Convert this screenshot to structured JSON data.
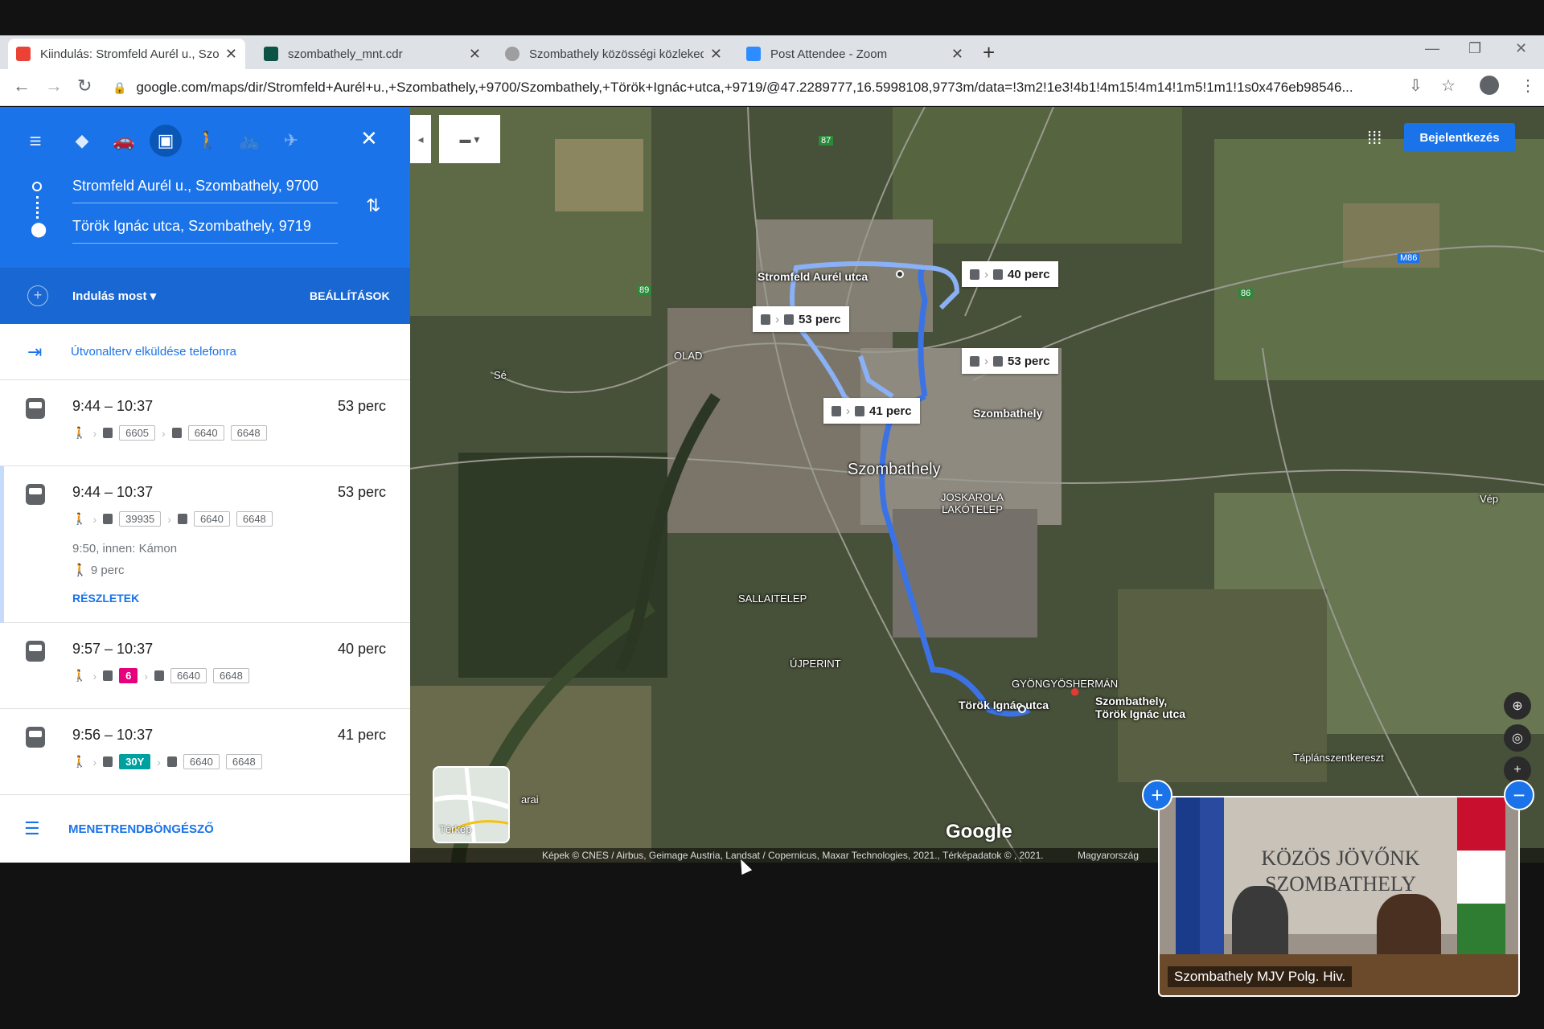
{
  "browser": {
    "tabs": [
      {
        "title": "Kiindulás: Stromfeld Aurél u., Szo",
        "favicon_color": "#ea4335"
      },
      {
        "title": "szombathely_mnt.cdr",
        "favicon_color": "#0b5345"
      },
      {
        "title": "Szombathely közösségi közleked",
        "favicon_color": "#9e9e9e"
      },
      {
        "title": "Post Attendee - Zoom",
        "favicon_color": "#2d8cff"
      }
    ],
    "url": "google.com/maps/dir/Stromfeld+Aurél+u.,+Szombathely,+9700/Szombathely,+Török+Ignác+utca,+9719/@47.2289777,16.5998108,9773m/data=!3m2!1e3!4b1!4m15!4m14!1m5!1m1!1s0x476eb98546..."
  },
  "directions": {
    "origin": "Stromfeld Aurél u., Szombathely, 9700",
    "destination": "Török Ignác utca, Szombathely, 9719",
    "departure": "Indulás most",
    "settings": "BEÁLLÍTÁSOK",
    "send_to_phone": "Útvonalterv elküldése telefonra",
    "schedule_explorer": "MENETRENDBÖNGÉSZŐ",
    "routes": [
      {
        "time": "9:44 – 10:37",
        "duration": "53 perc",
        "first": "6605",
        "second": [
          "6640",
          "6648"
        ]
      },
      {
        "time": "9:44 – 10:37",
        "duration": "53 perc",
        "first": "39935",
        "second": [
          "6640",
          "6648"
        ],
        "note": "9:50, innen: Kámon",
        "walk": "9 perc",
        "details": "RÉSZLETEK"
      },
      {
        "time": "9:57 – 10:37",
        "duration": "40 perc",
        "first": "6",
        "second": [
          "6640",
          "6648"
        ]
      },
      {
        "time": "9:56 – 10:37",
        "duration": "41 perc",
        "first": "30Y",
        "second": [
          "6640",
          "6648"
        ]
      }
    ]
  },
  "map": {
    "signin": "Bejelentkezés",
    "callouts": [
      "40 perc",
      "53 perc",
      "53 perc",
      "41 perc"
    ],
    "labels": {
      "origin": "Stromfeld Aurél utca",
      "station": "Szombathely",
      "city": "Szombathely",
      "olad": "OLAD",
      "se": "Sé",
      "joskarola": "JOSKAROLA\nLAKÓTELEP",
      "sallai": "SALLAITELEP",
      "ujperint": "ÚJPERINT",
      "gyongyos": "GYÖNGYÖSHERMÁN",
      "dest": "Török Ignác utca",
      "dest2": "Szombathely,\nTörök Ignác utca",
      "vep": "Vép",
      "taplan": "Táplánszentkereszt",
      "pin_label": "arai",
      "road_m86": "M86",
      "road_89": "89",
      "road_87": "87",
      "road_86": "86"
    },
    "layer_thumb": "Térkép",
    "logo": "Google",
    "attribution": "Képek © CNES / Airbus, Geimage Austria, Landsat / Copernicus, Maxar Technologies, 2021., Térképadatok © , 2021.",
    "region": "Magyarország"
  },
  "video": {
    "slogan": "KÖZÖS JÖVŐNK SZOMBATHELY",
    "name": "Szombathely MJV Polg. Hiv."
  }
}
